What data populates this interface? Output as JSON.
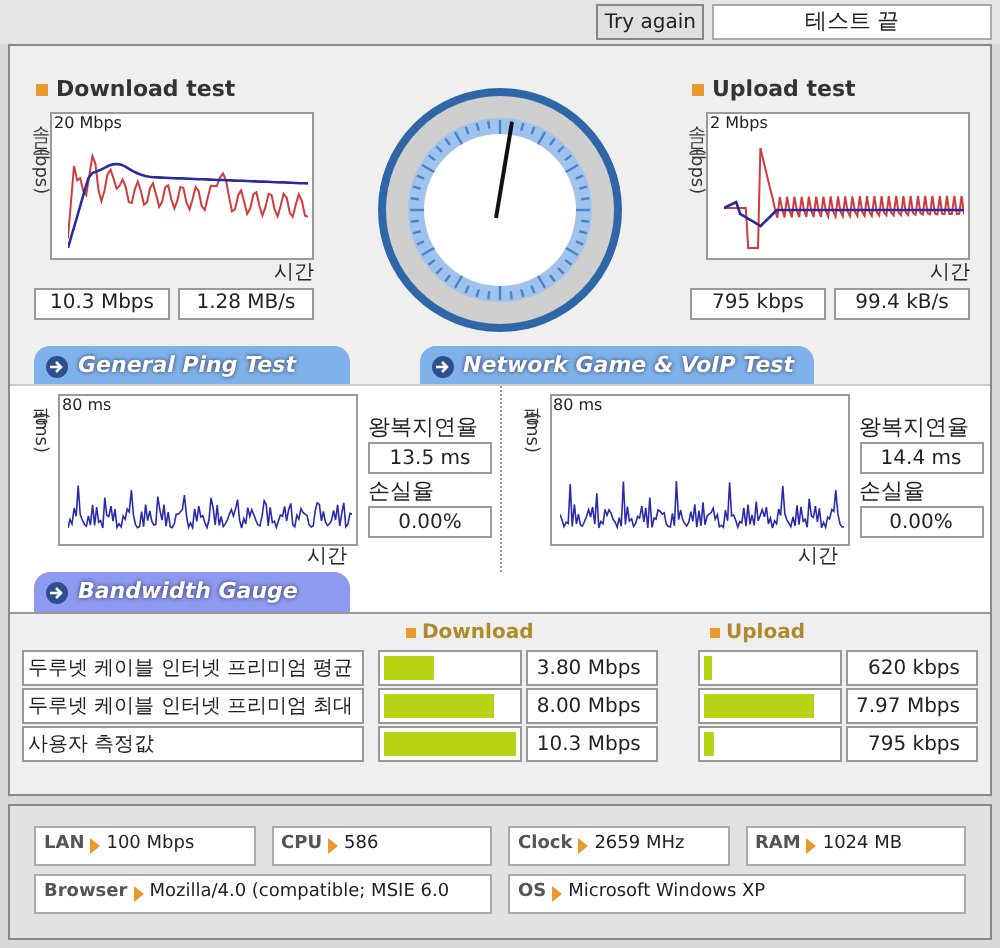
{
  "toolbar": {
    "try_again": "Try again",
    "status": "테스트 끝"
  },
  "download": {
    "title": "Download test",
    "ylabel": "속도(bps)",
    "top_label": "20 Mbps",
    "xlabel": "시간",
    "readings": [
      "10.3 Mbps",
      "1.28 MB/s"
    ]
  },
  "upload": {
    "title": "Upload test",
    "ylabel": "속도(bps)",
    "top_label": "2 Mbps",
    "xlabel": "시간",
    "readings": [
      "795 kbps",
      "99.4 kB/s"
    ]
  },
  "ping_tests": [
    {
      "tab": "General Ping Test",
      "ylabel": "핑(ms)",
      "top_label": "80 ms",
      "xlabel": "시간",
      "rtt_label": "왕복지연율",
      "rtt": "13.5 ms",
      "loss_label": "손실율",
      "loss": "0.00%"
    },
    {
      "tab": "Network Game & VoIP Test",
      "ylabel": "핑(ms)",
      "top_label": "80 ms",
      "xlabel": "시간",
      "rtt_label": "왕복지연율",
      "rtt": "14.4 ms",
      "loss_label": "손실율",
      "loss": "0.00%"
    }
  ],
  "bandwidth": {
    "tab": "Bandwidth Gauge",
    "columns": [
      "Download",
      "Upload"
    ],
    "rows": [
      {
        "name": "두루넷 케이블 인터넷 프리미엄 평균",
        "download": {
          "level": 0.37,
          "value": "3.80 Mbps"
        },
        "upload": {
          "level": 0.06,
          "value": "620 kbps"
        }
      },
      {
        "name": "두루넷 케이블 인터넷 프리미엄 최대",
        "download": {
          "level": 0.83,
          "value": "8.00 Mbps"
        },
        "upload": {
          "level": 0.83,
          "value": "7.97 Mbps"
        }
      },
      {
        "name": "사용자 측정값",
        "download": {
          "level": 1.0,
          "value": "10.3 Mbps"
        },
        "upload": {
          "level": 0.08,
          "value": "795 kbps"
        }
      }
    ]
  },
  "system_info": [
    {
      "label": "LAN",
      "value": "100 Mbps"
    },
    {
      "label": "CPU",
      "value": "586"
    },
    {
      "label": "Clock",
      "value": "2659 MHz"
    },
    {
      "label": "RAM",
      "value": "1024 MB"
    },
    {
      "label": "Browser",
      "value": "Mozilla/4.0 (compatible; MSIE 6.0",
      "wide": true
    },
    {
      "label": "OS",
      "value": "Microsoft Windows XP",
      "wide": true
    }
  ]
}
